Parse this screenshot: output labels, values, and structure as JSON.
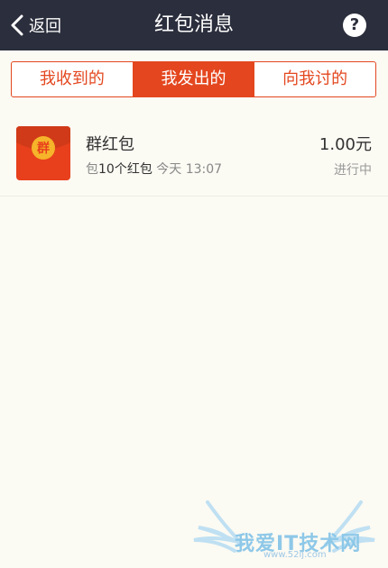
{
  "header": {
    "back_label": "返回",
    "title": "红包消息",
    "help_glyph": "?"
  },
  "tabs": [
    {
      "label": "我收到的",
      "active": false
    },
    {
      "label": "我发出的",
      "active": true
    },
    {
      "label": "向我讨的",
      "active": false
    }
  ],
  "items": [
    {
      "icon_text": "群",
      "title": "群红包",
      "prefix": "包",
      "count": "10个红包",
      "time": "今天 13:07",
      "amount": "1.00元",
      "status": "进行中"
    }
  ],
  "watermark": {
    "text": "我爱IT技术网",
    "url": "www.52ij.com"
  },
  "colors": {
    "accent": "#e4471f",
    "header_bg": "#2b2e3c",
    "page_bg": "#fbfaf3"
  }
}
